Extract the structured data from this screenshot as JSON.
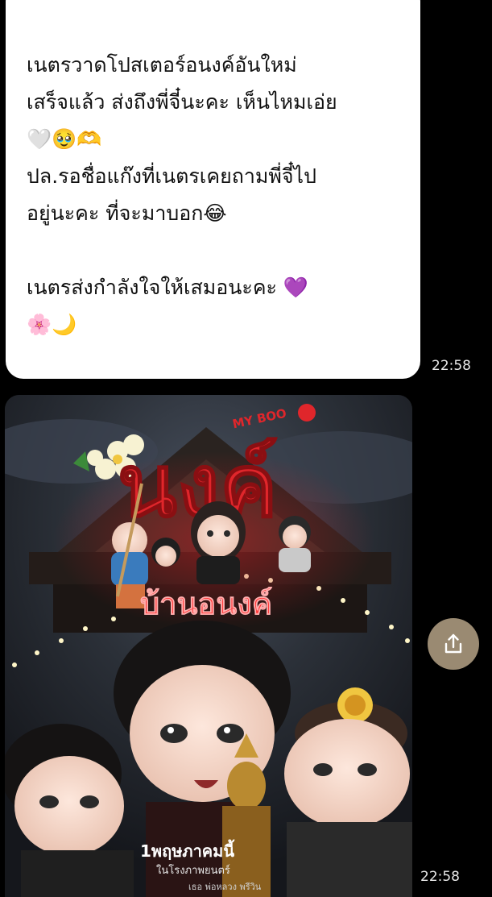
{
  "messages": [
    {
      "lines": [
        "เนตรวาดโปสเตอร์อนงค์อันใหม่",
        "เสร็จแล้ว ส่งถึงพี่จี๋นะคะ เห็นไหมเอ่ย",
        "🤍🥹🫶",
        "ปล.รอชื่อแก๊งที่เนตรเคยถามพี่จี๋ไป",
        "อยู่นะคะ ที่จะมาบอก😂",
        "",
        "เนตรส่งกำลังใจให้เสมอนะคะ 💜",
        "🌸🌙"
      ],
      "time": "22:58"
    },
    {
      "poster": {
        "title_small": "MY BOO",
        "title_main": "นงค์",
        "subtitle": "บ้านอนงค์",
        "release_date": "1พฤษภาคมนี้",
        "cinema_line": "ในโรงภาพยนตร์",
        "credit_line": "เธอ พ่อหลวง พรีวิน"
      },
      "time": "22:58"
    }
  ],
  "share_button": {
    "icon": "share-icon"
  },
  "colors": {
    "background": "#000000",
    "bubble": "#ffffff",
    "share": "#9a8a72",
    "poster_red": "#e0262b"
  }
}
